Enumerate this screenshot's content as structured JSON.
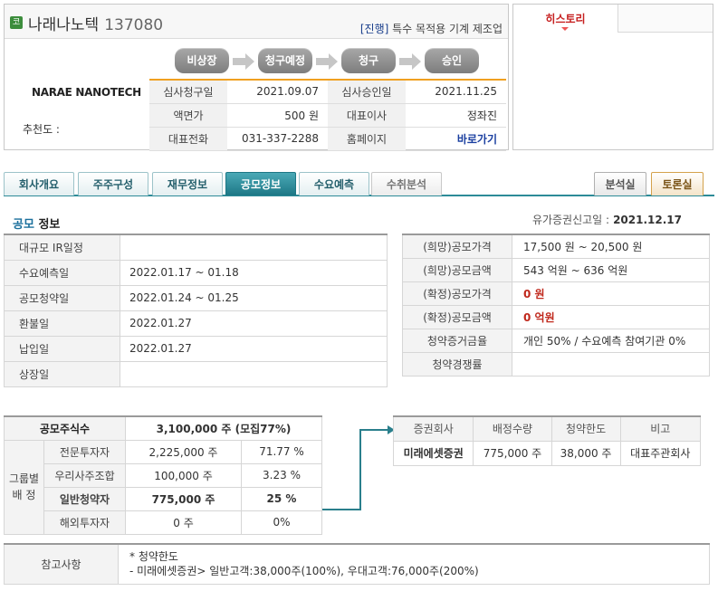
{
  "header": {
    "logo_badge": "코",
    "company_name": "나래나노텍",
    "company_code": "137080",
    "status_tag": "[진행]",
    "status_text": "특수 목적용 기계 제조업",
    "english_name": "NARAE NANOTECH",
    "recommend_label": "추천도 :"
  },
  "steps": [
    "비상장",
    "청구예정",
    "청구",
    "승인"
  ],
  "info": {
    "rows": [
      {
        "l1": "심사청구일",
        "v1": "2021.09.07",
        "l2": "심사승인일",
        "v2": "2021.11.25"
      },
      {
        "l1": "액면가",
        "v1": "500 원",
        "l2": "대표이사",
        "v2": "정좌진"
      },
      {
        "l1": "대표전화",
        "v1": "031-337-2288",
        "l2": "홈페이지",
        "v2": "바로가기"
      }
    ]
  },
  "history": {
    "tab_label": "히스토리"
  },
  "tabs": {
    "items": [
      "회사개요",
      "주주구성",
      "재무정보",
      "공모정보",
      "수요예측",
      "수취분석"
    ],
    "active": "공모정보",
    "right_items": [
      "분석실",
      "토론실"
    ]
  },
  "section": {
    "title_hl": "공모",
    "title_rest": "정보",
    "filed_label": "유가증권신고일 :",
    "filed_date": "2021.12.17"
  },
  "schedule": [
    {
      "label": "대규모 IR일정",
      "value": ""
    },
    {
      "label": "수요예측일",
      "value": "2022.01.17 ~ 01.18"
    },
    {
      "label": "공모청약일",
      "value": "2022.01.24 ~ 01.25"
    },
    {
      "label": "환불일",
      "value": "2022.01.27"
    },
    {
      "label": "납입일",
      "value": "2022.01.27"
    },
    {
      "label": "상장일",
      "value": ""
    }
  ],
  "pricing": [
    {
      "label": "(희망)공모가격",
      "value": "17,500 원 ~ 20,500 원"
    },
    {
      "label": "(희망)공모금액",
      "value": "543 억원  ~ 636 억원"
    },
    {
      "label": "(확정)공모가격",
      "value": "0 원"
    },
    {
      "label": "(확정)공모금액",
      "value": "0 억원"
    },
    {
      "label": "청약증거금율",
      "value": "개인 50% / 수요예측 참여기관 0%"
    },
    {
      "label": "청약경쟁률",
      "value": ""
    }
  ],
  "allocation": {
    "total_label": "공모주식수",
    "total_value": "3,100,000  주 (모집77%)",
    "group_label_1": "그룹별",
    "group_label_2": "배  정",
    "rows": [
      {
        "label": "전문투자자",
        "shares": "2,225,000 주",
        "pct": "71.77 %"
      },
      {
        "label": "우리사주조합",
        "shares": "100,000 주",
        "pct": "3.23 %"
      },
      {
        "label": "일반청약자",
        "shares": "775,000 주",
        "pct": "25 %"
      },
      {
        "label": "해외투자자",
        "shares": "0 주",
        "pct": "0%"
      }
    ]
  },
  "underwriters": {
    "headers": [
      "증권회사",
      "배정수량",
      "청약한도",
      "비고"
    ],
    "rows": [
      {
        "company": "미래에셋증권",
        "qty": "775,000 주",
        "limit": "38,000 주",
        "note": "대표주관회사"
      }
    ]
  },
  "notes": {
    "label": "참고사항",
    "line1": "* 청약한도",
    "line2": "- 미래에셋증권> 일반고객:38,000주(100%), 우대고객:76,000주(200%)"
  }
}
